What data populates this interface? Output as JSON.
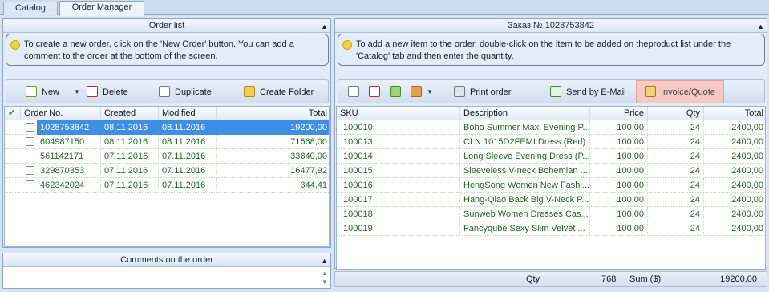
{
  "tabs": [
    {
      "label": "Catalog"
    },
    {
      "label": "Order Manager"
    }
  ],
  "order_list": {
    "title": "Order list",
    "hint": "To create a new order, click on the 'New Order' button. You can add a comment to the order at the bottom of the screen.",
    "toolbar": {
      "new": "New",
      "delete": "Delete",
      "duplicate": "Duplicate",
      "create_folder": "Create Folder"
    },
    "columns": [
      "Order No.",
      "Created",
      "Modified",
      "Total"
    ],
    "rows": [
      {
        "order_no": "1028753842",
        "created": "08.11.2016",
        "modified": "08.11.2016",
        "total": "19200,00"
      },
      {
        "order_no": "604987150",
        "created": "08.11.2016",
        "modified": "08.11.2016",
        "total": "71568,00"
      },
      {
        "order_no": "561142171",
        "created": "07.11.2016",
        "modified": "07.11.2016",
        "total": "33840,00"
      },
      {
        "order_no": "329870353",
        "created": "07.11.2016",
        "modified": "07.11.2016",
        "total": "16477,92"
      },
      {
        "order_no": "462342024",
        "created": "07.11.2016",
        "modified": "07.11.2016",
        "total": "344,41"
      }
    ],
    "selected_row": 0
  },
  "comments": {
    "title": "Comments on the order",
    "value": ""
  },
  "order_detail": {
    "title": "Заказ № 1028753842",
    "hint": "To add a new item to the order, double-click on the item to be added on theproduct list under the 'Catalog' tab and then enter the quantity.",
    "toolbar": {
      "print": "Print order",
      "email": "Send by E-Mail",
      "invoice": "Invoice/Quote"
    },
    "columns": [
      "SKU",
      "Description",
      "Price",
      "Qty",
      "Total"
    ],
    "rows": [
      {
        "sku": "100010",
        "desc": "Boho Summer Maxi Evening P...",
        "price": "100,00",
        "qty": "24",
        "total": "2400,00"
      },
      {
        "sku": "100013",
        "desc": "CLN 1015D2FEMI Dress (Red)",
        "price": "100,00",
        "qty": "24",
        "total": "2400,00"
      },
      {
        "sku": "100014",
        "desc": "Long Sleeve Evening Dress (P...",
        "price": "100,00",
        "qty": "24",
        "total": "2400,00"
      },
      {
        "sku": "100015",
        "desc": "Sleeveless V-neck Bohemian ...",
        "price": "100,00",
        "qty": "24",
        "total": "2400,00"
      },
      {
        "sku": "100016",
        "desc": "HengSong Women New Fashi...",
        "price": "100,00",
        "qty": "24",
        "total": "2400,00"
      },
      {
        "sku": "100017",
        "desc": "Hang-Qiao Back Big V-Neck P...",
        "price": "100,00",
        "qty": "24",
        "total": "2400,00"
      },
      {
        "sku": "100018",
        "desc": "Sunweb Women Dresses Cas...",
        "price": "100,00",
        "qty": "24",
        "total": "2400,00"
      },
      {
        "sku": "100019",
        "desc": "Fancyqube Sexy Slim Velvet ...",
        "price": "100,00",
        "qty": "24",
        "total": "2400,00"
      }
    ],
    "footer": {
      "qty_label": "Qty",
      "qty_value": "768",
      "sum_label": "Sum ($)",
      "sum_value": "19200,00"
    }
  },
  "colors": {
    "accent_selected": "#3f8ee6",
    "grid_text": "#1e6f1e",
    "invoice_highlight": "#f7c9c4"
  }
}
